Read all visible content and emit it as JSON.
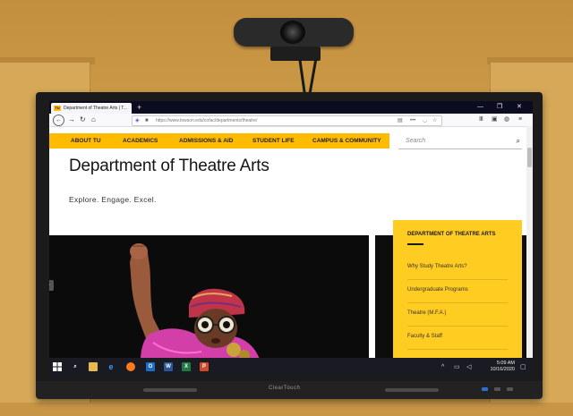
{
  "browser": {
    "tab_title": "Department of Theatre Arts | T...",
    "tab_favicon": "TU",
    "new_tab": "+",
    "url": "https://www.towson.edu/cofac/departments/theatre/",
    "window_controls": [
      "—",
      "❐",
      "✕"
    ]
  },
  "site_nav": {
    "items": [
      "ABOUT TU",
      "ACADEMICS",
      "ADMISSIONS & AID",
      "STUDENT LIFE",
      "CAMPUS & COMMUNITY"
    ],
    "search_placeholder": "Search"
  },
  "page": {
    "title": "Department of Theatre Arts",
    "tagline": "Explore. Engage. Excel."
  },
  "sidebar": {
    "title": "DEPARTMENT OF THEATRE ARTS",
    "items": [
      "Why Study Theatre Arts?",
      "Undergraduate Programs",
      "Theatre (M.F.A.)",
      "Faculty & Staff"
    ]
  },
  "taskbar": {
    "time": "5:09 AM",
    "date": "10/16/2020"
  },
  "monitor": {
    "brand": "ClearTouch"
  },
  "colors": {
    "tu_gold": "#ffbb00",
    "sidebar_gold": "#ffcc22",
    "wall": "#d6a857",
    "hero_bg": "#0b0b0b"
  }
}
